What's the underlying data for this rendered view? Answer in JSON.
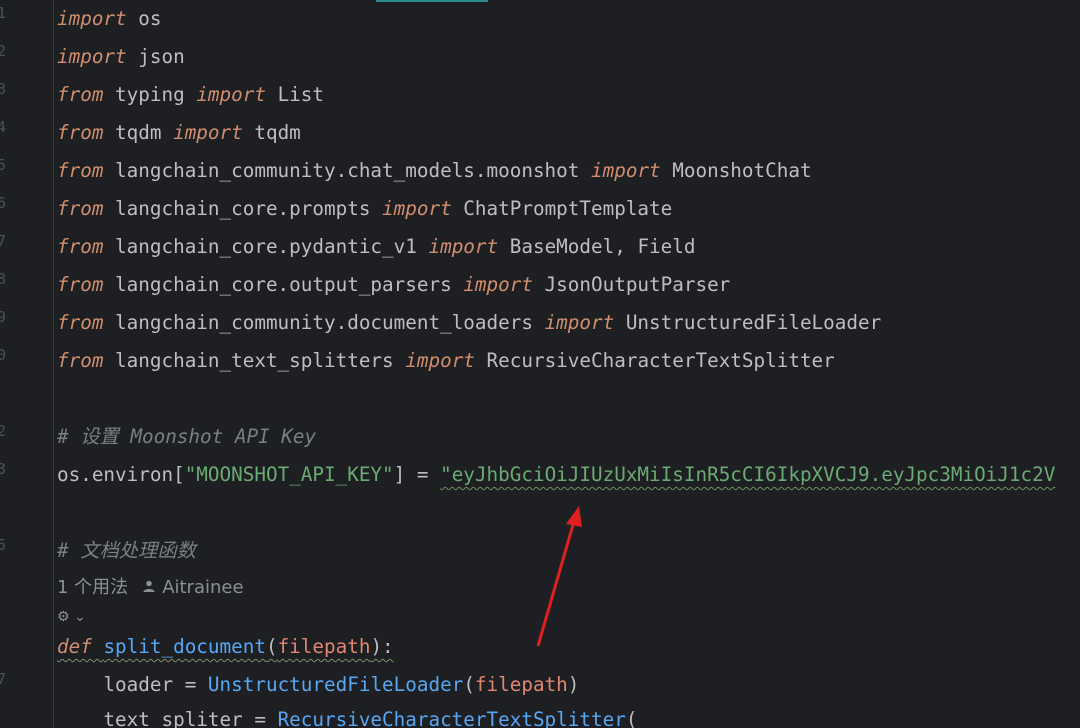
{
  "editor": {
    "line_numbers": [
      "1",
      "2",
      "3",
      "4",
      "5",
      "6",
      "7",
      "8",
      "9",
      "0",
      "",
      "2",
      "3",
      "",
      "5",
      "",
      "",
      "",
      "",
      "7",
      ""
    ],
    "code": {
      "l1": {
        "kw": "import",
        "rest": " os"
      },
      "l2": {
        "kw": "import",
        "rest": " json"
      },
      "l3": {
        "kw1": "from",
        "mod": " typing ",
        "kw2": "import",
        "name": " List"
      },
      "l4": {
        "kw1": "from",
        "mod": " tqdm ",
        "kw2": "import",
        "name": " tqdm"
      },
      "l5": {
        "kw1": "from",
        "mod": " langchain_community.chat_models.moonshot ",
        "kw2": "import",
        "name": " MoonshotChat"
      },
      "l6": {
        "kw1": "from",
        "mod": " langchain_core.prompts ",
        "kw2": "import",
        "name": " ChatPromptTemplate"
      },
      "l7": {
        "kw1": "from",
        "mod": " langchain_core.pydantic_v1 ",
        "kw2": "import",
        "name": " BaseModel, Field"
      },
      "l8": {
        "kw1": "from",
        "mod": " langchain_core.output_parsers ",
        "kw2": "import",
        "name": " JsonOutputParser"
      },
      "l9": {
        "kw1": "from",
        "mod": " langchain_community.document_loaders ",
        "kw2": "import",
        "name": " UnstructuredFileLoader"
      },
      "l10": {
        "kw1": "from",
        "mod": " langchain_text_splitters ",
        "kw2": "import",
        "name": " RecursiveCharacterTextSplitter"
      },
      "comment1": "# 设置 Moonshot API Key",
      "env_prefix": "os.environ[",
      "env_key": "\"MOONSHOT_API_KEY\"",
      "env_mid": "] = ",
      "env_value": "\"eyJhbGciOiJIUzUxMiIsInR5cCI6IkpXVCJ9.eyJpc3MiOiJ1c2V",
      "comment2": "# 文档处理函数",
      "usage_hint": "1 个用法",
      "author": "Aitrainee",
      "ai_icon_label": "⚙ ⌄",
      "def_kw": "def",
      "def_name": "split_document",
      "def_param": "filepath",
      "def_tail": "):",
      "loader_lhs": "    loader = ",
      "loader_cls": "UnstructuredFileLoader",
      "loader_param": "filepath",
      "text_lhs": "    text_spliter = ",
      "text_cls": "RecursiveCharacterTextSplitter",
      "text_tail": "("
    }
  },
  "colors": {
    "background": "#1e1f22",
    "keyword": "#cf8e6d",
    "string": "#6aab73",
    "class": "#56a8f5",
    "comment": "#7a7e85",
    "annotation_arrow": "#e02020"
  }
}
